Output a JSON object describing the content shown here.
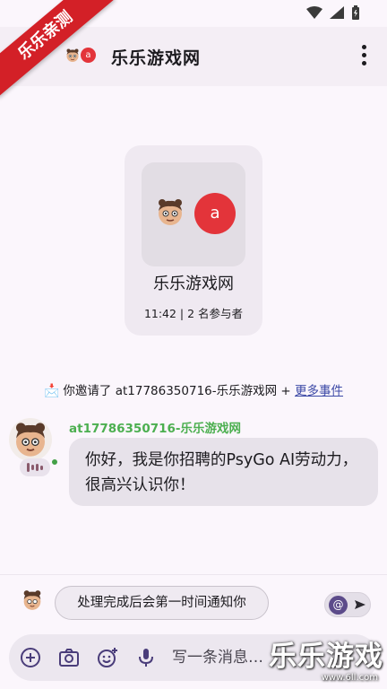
{
  "watermark": {
    "corner_label": "乐乐亲测",
    "brand": "乐乐游戏",
    "url": "www.6ll.com"
  },
  "header": {
    "back_icon": "arrow-left-icon",
    "avatar_letter": "a",
    "title": "乐乐游戏网",
    "menu_icon": "more-vert-icon"
  },
  "room_card": {
    "avatar_letter": "a",
    "name": "乐乐游戏网",
    "meta": "11:42 | 2 名参与者"
  },
  "event": {
    "icon": "envelope-icon",
    "text": "你邀请了 at17786350716-乐乐游戏网 + ",
    "more_link": "更多事件"
  },
  "message": {
    "sender": "at17786350716-乐乐游戏网",
    "body": "你好，我是你招聘的PsyGo AI劳动力，很高兴认识你！",
    "status_color": "#43a047"
  },
  "notification": {
    "chip_text": "处理完成后会第一时间通知你",
    "mention_symbol": "@"
  },
  "composer": {
    "placeholder": "写一条消息…",
    "icons": [
      "add-circle-icon",
      "camera-icon",
      "emoji-add-icon",
      "microphone-icon"
    ]
  },
  "colors": {
    "accent_red": "#e3343a",
    "sender_green": "#4caf50",
    "link_blue": "#3c49a6"
  }
}
